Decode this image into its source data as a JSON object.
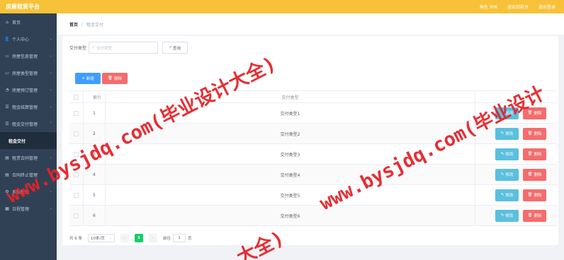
{
  "header": {
    "title": "房屋租赁平台",
    "role": "角色 308",
    "link_home": "退出到前台",
    "link_logout": "退出登录"
  },
  "sidebar": {
    "items": [
      {
        "label": "首页",
        "icon": "home-icon"
      },
      {
        "label": "个人中心",
        "icon": "user-icon"
      },
      {
        "label": "房屋信息管理",
        "icon": "house-icon"
      },
      {
        "label": "房屋类型管理",
        "icon": "house-icon"
      },
      {
        "label": "房屋预订管理",
        "icon": "reserve-icon"
      },
      {
        "label": "租金结算管理",
        "icon": "list-icon"
      },
      {
        "label": "租金交付管理",
        "icon": "list-icon"
      },
      {
        "label": "租金交付",
        "sub": true
      },
      {
        "label": "租赁合同管理",
        "icon": "contract-icon"
      },
      {
        "label": "合同终止管理",
        "icon": "contract-icon"
      },
      {
        "label": "系统管理",
        "icon": "gear-icon"
      },
      {
        "label": "日程管理",
        "icon": "calendar-icon"
      }
    ]
  },
  "breadcrumb": {
    "home": "首页",
    "sep": "/",
    "current": "租金交付"
  },
  "search": {
    "label": "交付类型",
    "placeholder": "交付类型",
    "button": "查询"
  },
  "toolbar": {
    "add_label": "新增",
    "delete_label": "删除"
  },
  "table": {
    "headers": {
      "index": "索引",
      "type": "交付类型"
    },
    "rows": [
      {
        "index": "1",
        "type": "交付类型1",
        "edit": "修改",
        "delete": "删除"
      },
      {
        "index": "2",
        "type": "交付类型2",
        "edit": "修改",
        "delete": "删除"
      },
      {
        "index": "3",
        "type": "交付类型3",
        "edit": "修改",
        "delete": "删除"
      },
      {
        "index": "4",
        "type": "交付类型4",
        "edit": "修改",
        "delete": "删除"
      },
      {
        "index": "5",
        "type": "交付类型5",
        "edit": "修改",
        "delete": "删除"
      },
      {
        "index": "6",
        "type": "交付类型6",
        "edit": "修改",
        "delete": "删除"
      }
    ]
  },
  "pagination": {
    "total": "共 6 条",
    "page_size": "10条/页",
    "current_page": "1",
    "goto_label": "前往",
    "goto_value": "1",
    "page_suffix": "页"
  },
  "watermark": {
    "text1": "www.bysjdq.com(毕业设计大全)",
    "text2": "www.bysjdq.com(毕业设计",
    "text3": "大全)"
  },
  "colors": {
    "header": "#f7c23a",
    "sidebar": "#304156",
    "primary": "#409eff",
    "danger": "#f56c6c",
    "info": "#5bc0de",
    "success": "#13ce66",
    "watermark": "#e4242a"
  }
}
